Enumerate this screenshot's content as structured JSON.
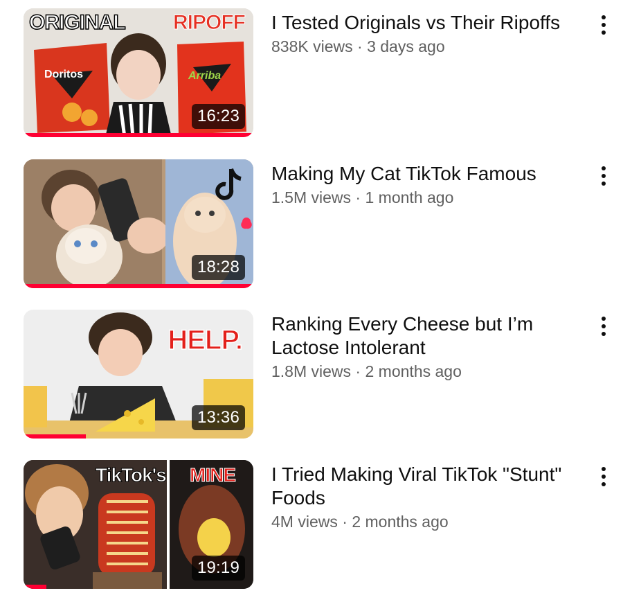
{
  "videos": [
    {
      "title": "I Tested Originals vs Their Ripoffs",
      "views": "838K views",
      "age": "3 days ago",
      "duration": "16:23",
      "thumb_labels": [
        "ORIGINAL",
        "RIPOFF"
      ],
      "watched_fraction": 1.0
    },
    {
      "title": "Making My Cat TikTok Famous",
      "views": "1.5M views",
      "age": "1 month ago",
      "duration": "18:28",
      "thumb_labels": [],
      "watched_fraction": 1.0
    },
    {
      "title": "Ranking Every Cheese but I’m Lactose Intolerant",
      "views": "1.8M views",
      "age": "2 months ago",
      "duration": "13:36",
      "thumb_labels": [
        "HELP."
      ],
      "watched_fraction": 0.27
    },
    {
      "title": "I Tried Making Viral TikTok \"Stunt\" Foods",
      "views": "4M views",
      "age": "2 months ago",
      "duration": "19:19",
      "thumb_labels": [
        "TikTok's",
        "MINE"
      ],
      "watched_fraction": 0.1
    }
  ],
  "separator": " · ",
  "icons": {
    "menu": "more-vert-icon"
  },
  "colors": {
    "progress": "#ff0033",
    "meta_text": "#606060",
    "title_text": "#0f0f0f"
  }
}
